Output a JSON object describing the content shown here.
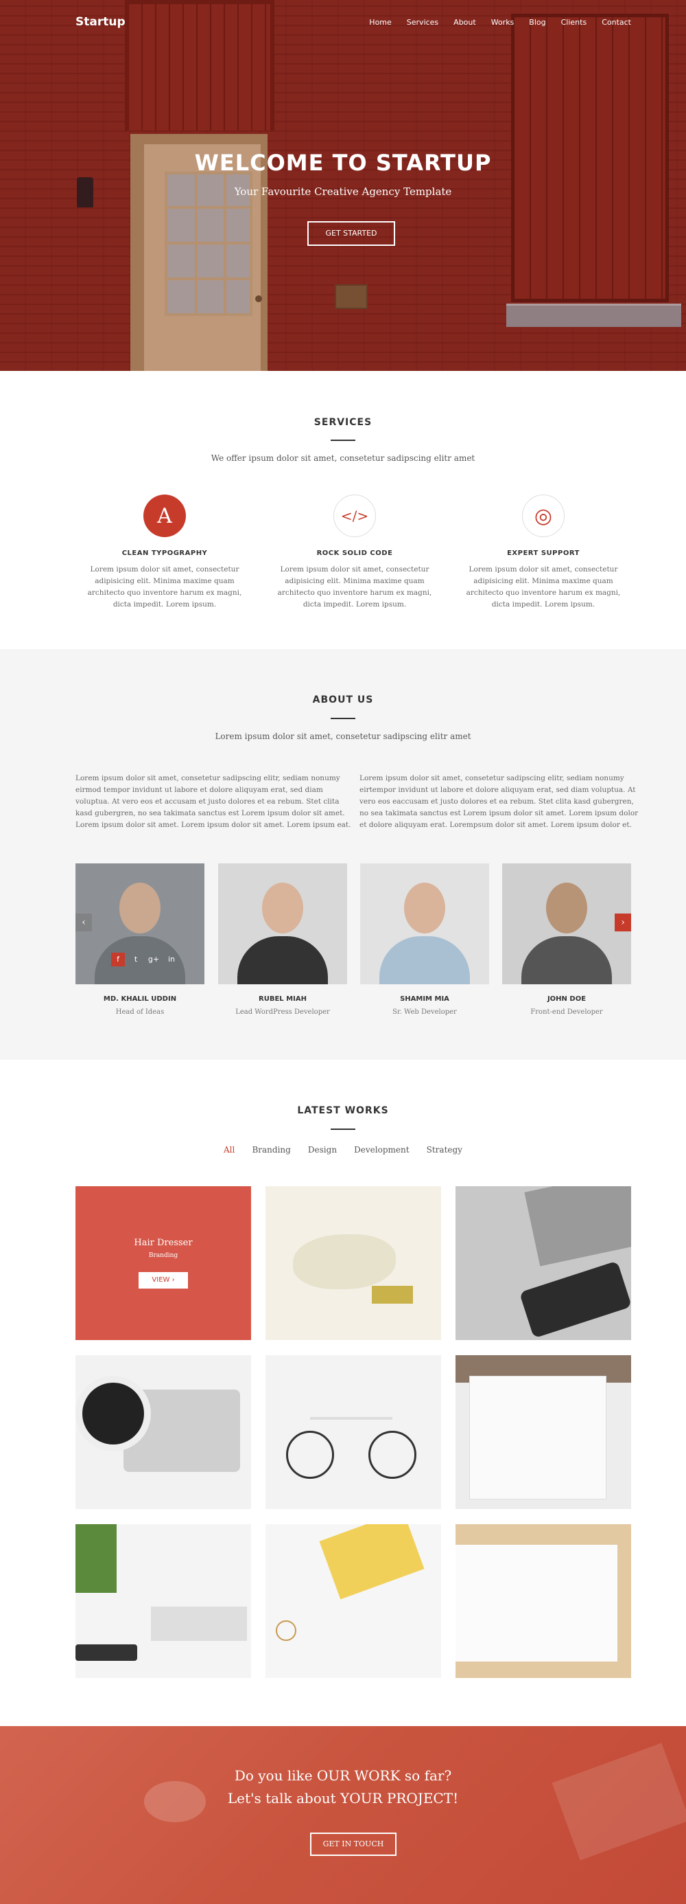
{
  "nav": {
    "brand": "Startup",
    "items": [
      "Home",
      "Services",
      "About",
      "Works",
      "Blog",
      "Clients",
      "Contact"
    ]
  },
  "hero": {
    "title": "WELCOME TO STARTUP",
    "subtitle": "Your Favourite Creative Agency Template",
    "button": "GET STARTED"
  },
  "services": {
    "title": "SERVICES",
    "subtitle": "We offer ipsum dolor sit amet, consetetur sadipscing elitr amet",
    "items": [
      {
        "icon": "A",
        "name": "CLEAN TYPOGRAPHY",
        "text": "Lorem ipsum dolor sit amet, consectetur adipisicing elit. Minima maxime quam architecto quo inventore harum ex magni, dicta impedit. Lorem ipsum."
      },
      {
        "icon": "</>",
        "name": "ROCK SOLID CODE",
        "text": "Lorem ipsum dolor sit amet, consectetur adipisicing elit. Minima maxime quam architecto quo inventore harum ex magni, dicta impedit. Lorem ipsum."
      },
      {
        "icon": "◎",
        "name": "EXPERT SUPPORT",
        "text": "Lorem ipsum dolor sit amet, consectetur adipisicing elit. Minima maxime quam architecto quo inventore harum ex magni, dicta impedit. Lorem ipsum."
      }
    ]
  },
  "about": {
    "title": "ABOUT US",
    "subtitle": "Lorem ipsum dolor sit amet, consetetur sadipscing elitr amet",
    "col1": "Lorem ipsum dolor sit amet, consetetur sadipscing elitr, sediam nonumy eirmod tempor invidunt ut labore et dolore aliquyam erat, sed diam voluptua. At vero eos et accusam et justo dolores et ea rebum. Stet clita kasd gubergren, no sea takimata sanctus est Lorem ipsum dolor sit amet. Lorem ipsum dolor sit amet. Lorem ipsum dolor sit amet. Lorem ipsum eat.",
    "col2": "Lorem ipsum dolor sit amet, consetetur sadipscing elitr, sediam nonumy eirtempor invidunt ut labore et dolore aliquyam erat, sed diam voluptua. At vero eos eaccusam et justo dolores et ea rebum. Stet clita kasd gubergren, no sea takimata sanctus est Lorem ipsum dolor sit amet. Lorem ipsum dolor et dolore aliquyam erat. Lorempsum dolor sit amet. Lorem ipsum dolor et.",
    "team": [
      {
        "name": "MD. KHALIL UDDIN",
        "role": "Head of Ideas"
      },
      {
        "name": "RUBEL MIAH",
        "role": "Lead WordPress Developer"
      },
      {
        "name": "SHAMIM MIA",
        "role": "Sr. Web Developer"
      },
      {
        "name": "JOHN DOE",
        "role": "Front-end Developer"
      }
    ],
    "social": [
      "f",
      "t",
      "g+",
      "in"
    ]
  },
  "works": {
    "title": "LATEST WORKS",
    "filters": [
      "All",
      "Branding",
      "Design",
      "Development",
      "Strategy"
    ],
    "featured": {
      "title": "Hair Dresser",
      "category": "Branding",
      "button": "VIEW"
    }
  },
  "cta": {
    "line1": "Do you like OUR WORK so far?",
    "line2": "Let's talk about YOUR PROJECT!",
    "button": "GET IN TOUCH"
  },
  "colors": {
    "accent": "#c73b2b"
  }
}
